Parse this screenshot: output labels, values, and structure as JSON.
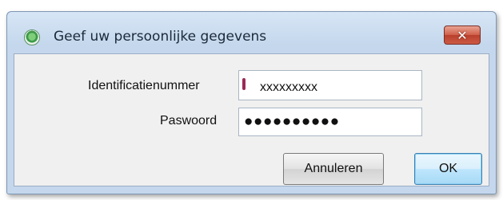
{
  "window": {
    "title": "Geef uw persoonlijke gegevens",
    "icon": "green-app-icon",
    "close_symbol": "✕"
  },
  "form": {
    "id_label": "Identificatienummer",
    "id_value": "xxxxxxxxx",
    "password_label": "Paswoord",
    "password_value": "●●●●●●●●●●"
  },
  "buttons": {
    "cancel_label": "Annuleren",
    "ok_label": "OK"
  },
  "colors": {
    "frame": "#c4d7ec",
    "close_button": "#c8503a",
    "client": "#f0f0f0"
  }
}
